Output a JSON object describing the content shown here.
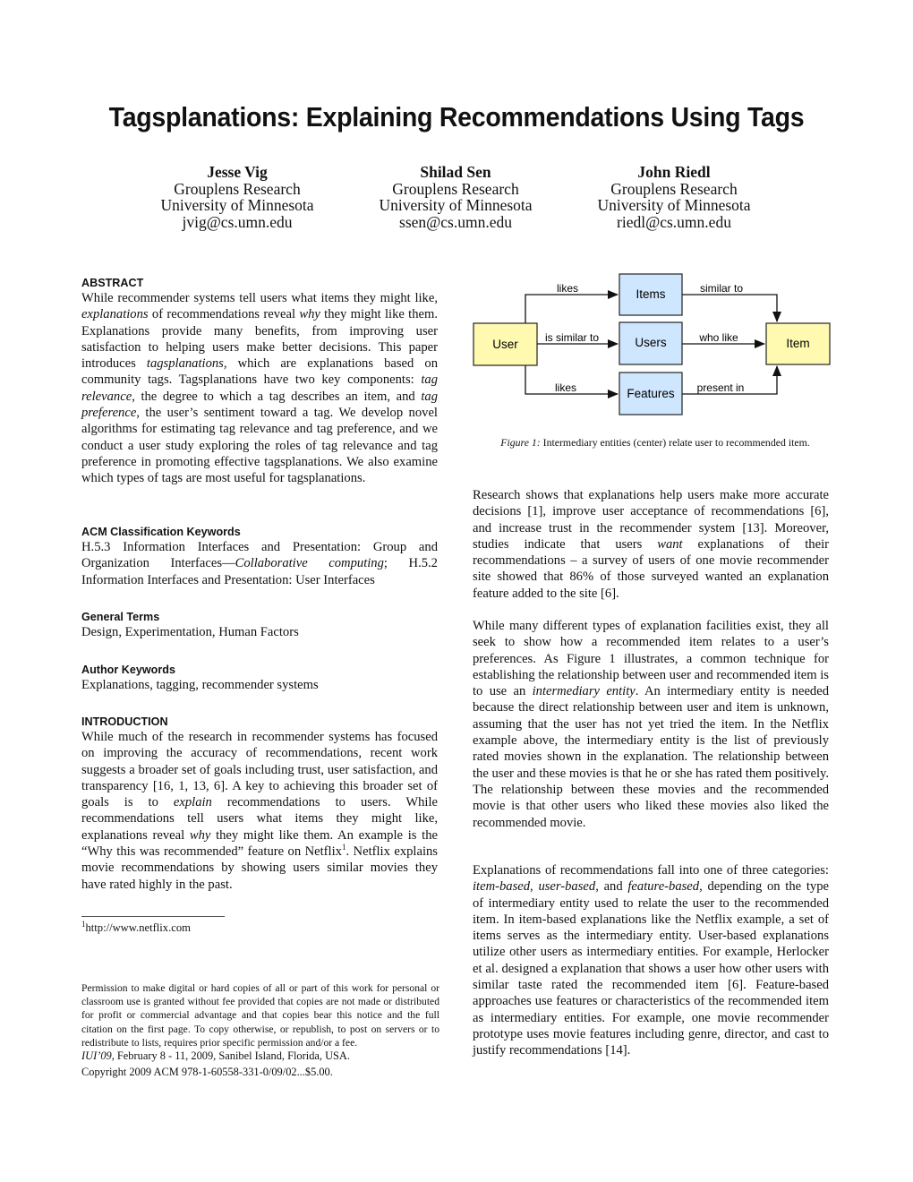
{
  "paper": {
    "title": "Tagsplanations: Explaining Recommendations Using Tags",
    "authors": [
      {
        "name": "Jesse Vig",
        "affiliation": "Grouplens Research",
        "institution": "University of Minnesota",
        "email": "jvig@cs.umn.edu"
      },
      {
        "name": "Shilad Sen",
        "affiliation": "Grouplens Research",
        "institution": "University of Minnesota",
        "email": "ssen@cs.umn.edu"
      },
      {
        "name": "John Riedl",
        "affiliation": "Grouplens Research",
        "institution": "University of Minnesota",
        "email": "riedl@cs.umn.edu"
      }
    ]
  },
  "left_column": {
    "abstract": {
      "heading": "ABSTRACT",
      "text_1": "While recommender systems tell users what items they might like, ",
      "em_1": "explanations",
      "text_2": " of recommendations reveal ",
      "em_2": "why",
      "text_3": " they might like them. Explanations provide many benefits, from improving user satisfaction to helping users make better decisions. This paper introduces ",
      "em_3": "tagsplanations",
      "text_4": ", which are explanations based on community tags. Tagsplanations have two key components: ",
      "em_4": "tag relevance",
      "text_5": ", the degree to which a tag describes an item, and ",
      "em_5": "tag preference",
      "text_6": ", the user’s sentiment toward a tag. We develop novel algorithms for estimating tag relevance and tag preference, and we conduct a user study exploring the roles of tag relevance and tag preference in promoting effective tagsplanations. We also examine which types of tags are most useful for tagsplanations."
    },
    "acm_keywords": {
      "heading": "ACM Classification Keywords",
      "text_1": "H.5.3 Information Interfaces and Presentation: Group and Organization Interfaces—",
      "em_1": "Collaborative computing",
      "text_2": "; H.5.2 Information Interfaces and Presentation: User Interfaces"
    },
    "general_terms": {
      "heading": "General Terms",
      "text": "Design, Experimentation, Human Factors"
    },
    "author_keywords": {
      "heading": "Author Keywords",
      "text": "Explanations, tagging, recommender systems"
    },
    "introduction": {
      "heading": "INTRODUCTION",
      "text_1": "While much of the research in recommender systems has focused on improving the accuracy of recommendations, recent work suggests a broader set of goals including trust, user satisfaction, and transparency [16, 1, 13, 6]. A key to achieving this broader set of goals is to ",
      "em_1": "explain",
      "text_2": " recommendations to users. While recommendations tell users what items they might like, explanations reveal ",
      "em_2": "why",
      "text_3": " they might like them. An example is the “Why this was recommended” feature on Netflix",
      "footnote_ref": "1",
      "text_4": ". Netflix explains movie recommendations by showing users similar movies they have rated highly in the past."
    },
    "footnote": {
      "mark": "1",
      "text": "http://www.netflix.com"
    },
    "permission": {
      "text": "Permission to make digital or hard copies of all or part of this work for personal or classroom use is granted without fee provided that copies are not made or distributed for profit or commercial advantage and that copies bear this notice and the full citation on the first page. To copy otherwise, or republish, to post on servers or to redistribute to lists, requires prior specific permission and/or a fee.",
      "venue_em": "IUI’09",
      "venue_text": ", February 8 - 11, 2009, Sanibel Island, Florida, USA.",
      "copyright": "Copyright 2009 ACM 978-1-60558-331-0/09/02...$5.00."
    }
  },
  "figure1": {
    "nodes": {
      "user": "User",
      "items": "Items",
      "users": "Users",
      "features": "Features",
      "item": "Item"
    },
    "edges": {
      "user_items": "likes",
      "user_users": "is similar to",
      "user_features": "likes",
      "items_item": "similar to",
      "users_item": "who like",
      "features_item": "present in"
    },
    "colors": {
      "endpoint_fill": "#FFFAB0",
      "intermediary_fill": "#CFE6FF",
      "stroke": "#222222"
    },
    "caption_label": "Figure 1:",
    "caption_text": " Intermediary entities (center) relate user to recommended item."
  },
  "right_column": {
    "para_1": {
      "text_1": "Research shows that explanations help users make more accurate decisions [1], improve user acceptance of recommendations [6], and increase trust in the recommender system [13]. Moreover, studies indicate that users ",
      "em_1": "want",
      "text_2": " explanations of their recommendations – a survey of users of one movie recommender site showed that 86% of those surveyed wanted an explanation feature added to the site [6]."
    },
    "para_2": {
      "text_1": "While many different types of explanation facilities exist, they all seek to show how a recommended item relates to a user’s preferences. As Figure 1 illustrates, a common technique for establishing the relationship between user and recommended item is to use an ",
      "em_1": "intermediary entity",
      "text_2": ". An intermediary entity is needed because the direct relationship between user and item is unknown, assuming that the user has not yet tried the item. In the Netflix example above, the intermediary entity is the list of previously rated movies shown in the explanation. The relationship between the user and these movies is that he or she has rated them positively. The relationship between these movies and the recommended movie is that other users who liked these movies also liked the recommended movie."
    },
    "para_3": {
      "text_1": "Explanations of recommendations fall into one of three categories: ",
      "em_1": "item-based",
      "text_2": ", ",
      "em_2": "user-based",
      "text_3": ", and ",
      "em_3": "feature-based",
      "text_4": ", depending on the type of intermediary entity used to relate the user to the recommended item. In item-based explanations like the Netflix example, a set of items serves as the intermediary entity. User-based explanations utilize other users as intermediary entities. For example, Herlocker et al. designed a explanation that shows a user how other users with similar taste rated the recommended item [6]. Feature-based approaches use features or characteristics of the recommended item as intermediary entities. For example, one movie recommender prototype uses movie features including genre, director, and cast to justify recommendations [14]."
    }
  }
}
